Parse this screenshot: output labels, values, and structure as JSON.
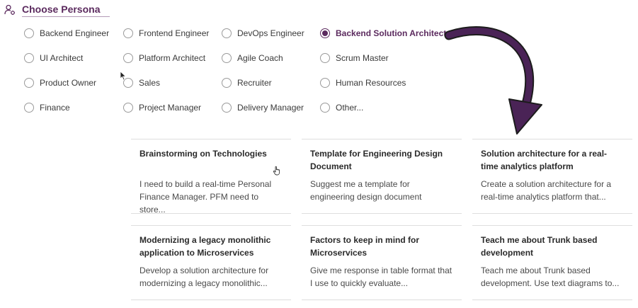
{
  "header": {
    "title": "Choose Persona",
    "icon": "persona-icon"
  },
  "persona_options": [
    "Backend Engineer",
    "Frontend Engineer",
    "DevOps Engineer",
    "Backend Solution Architect",
    "UI Architect",
    "Platform Architect",
    "Agile Coach",
    "Scrum Master",
    "Product Owner",
    "Sales",
    "Recruiter",
    "Human Resources",
    "Finance",
    "Project Manager",
    "Delivery Manager",
    "Other..."
  ],
  "selected_persona": "Backend Solution Architect",
  "colors": {
    "accent": "#5b2a5e",
    "arrow": "#4a2356"
  },
  "prompt_cards": [
    {
      "title": "Brainstorming on Technologies",
      "description": "I need to build a real-time Personal Finance Manager. PFM need to store..."
    },
    {
      "title": "Template for Engineering Design Document",
      "description": "Suggest me a template for engineering design document"
    },
    {
      "title": "Solution architecture for a real-time analytics platform",
      "description": "Create a solution architecture for a real-time analytics platform that..."
    },
    {
      "title": "Modernizing a legacy monolithic application to Microservices",
      "description": "Develop a solution architecture for modernizing a legacy monolithic..."
    },
    {
      "title": "Factors to keep in mind for Microservices",
      "description": "Give me response in table format that I use to quickly evaluate..."
    },
    {
      "title": "Teach me about Trunk based development",
      "description": "Teach me about Trunk based development. Use text diagrams to..."
    }
  ]
}
